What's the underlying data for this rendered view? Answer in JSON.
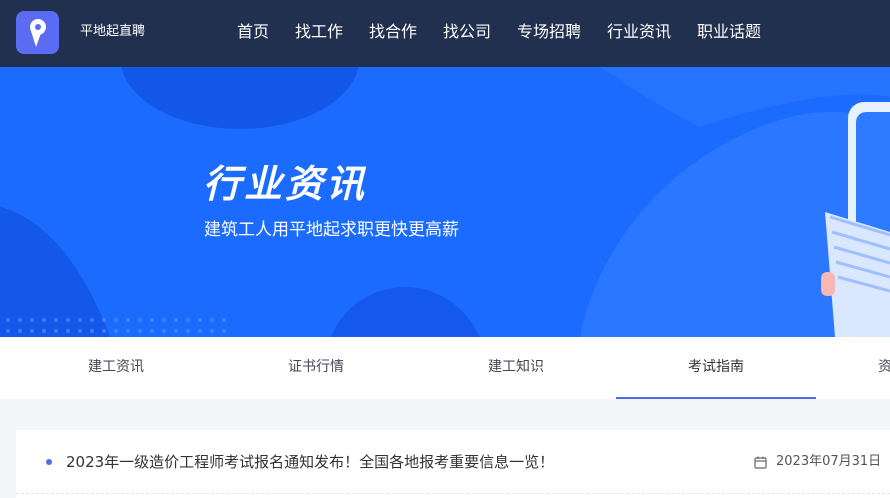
{
  "header": {
    "brand": "平地起直聘",
    "nav": [
      "首页",
      "找工作",
      "找合作",
      "找公司",
      "专场招聘",
      "行业资讯",
      "职业话题"
    ]
  },
  "banner": {
    "title": "行业资讯",
    "subtitle": "建筑工人用平地起求职更快更高薪"
  },
  "tabs": [
    {
      "label": "建工资讯",
      "active": false
    },
    {
      "label": "证书行情",
      "active": false
    },
    {
      "label": "建工知识",
      "active": false
    },
    {
      "label": "考试指南",
      "active": true
    },
    {
      "label": "资",
      "active": false
    }
  ],
  "articles": [
    {
      "title": "2023年一级造价工程师考试报名通知发布！全国各地报考重要信息一览！",
      "date": "2023年07月31日",
      "date_icon": "calendar-icon"
    }
  ],
  "colors": {
    "header_bg": "#21304e",
    "banner_bg": "#1b6bff",
    "accent": "#4f6bea"
  }
}
